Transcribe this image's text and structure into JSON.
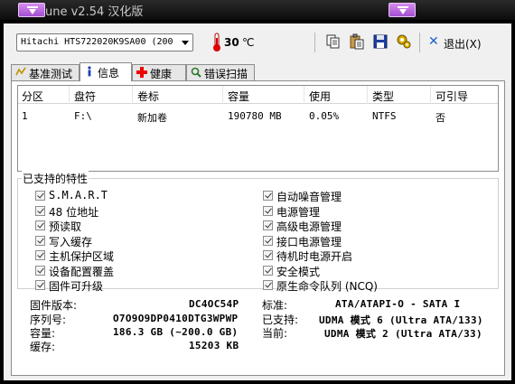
{
  "window": {
    "title": "une v2.54 汉化版",
    "accent_purple": "#b05ad8"
  },
  "toolbar": {
    "drive": "Hitachi HTS722020K9SA00 (200",
    "temperature": "30",
    "temperature_unit": "℃",
    "exit_label": "退出(X)",
    "icons": [
      "copy-icon",
      "paste-icon",
      "save-icon",
      "settings-icon"
    ]
  },
  "tabs": [
    {
      "label": "基准测试",
      "icon": "benchmark-icon"
    },
    {
      "label": "信息",
      "icon": "info-icon",
      "active": true
    },
    {
      "label": "健康",
      "icon": "health-cross-icon"
    },
    {
      "label": "错误扫描",
      "icon": "error-scan-icon"
    }
  ],
  "partitions": {
    "columns": [
      "分区",
      "盘符",
      "卷标",
      "容量",
      "使用",
      "类型",
      "可引导"
    ],
    "rows": [
      [
        "1",
        "F:\\",
        "新加卷",
        "190780 MB",
        "0.05%",
        "NTFS",
        "否"
      ]
    ]
  },
  "features": {
    "label": "已支持的特性",
    "left": [
      "S.M.A.R.T",
      "48 位地址",
      "预读取",
      "写入缓存",
      "主机保护区域",
      "设备配置覆盖",
      "固件可升级"
    ],
    "right": [
      "自动噪音管理",
      "电源管理",
      "高级电源管理",
      "接口电源管理",
      "待机时电源开启",
      "安全模式",
      "原生命令队列 (NCQ)"
    ]
  },
  "info": {
    "firmware_label": "固件版本:",
    "firmware_value": "DC4OC54P",
    "serial_label": "序列号:",
    "serial_value": "O7O9O9DP0410DTG3WPWP",
    "capacity_label": "容量:",
    "capacity_value": "186.3 GB (~200.0 GB)",
    "cache_label": "缓存:",
    "cache_value": "15203 KB",
    "standard_label": "标准:",
    "standard_value": "ATA/ATAPI-O - SATA I",
    "supported_label": "已支持:",
    "supported_value": "UDMA 模式 6 (Ultra ATA/133)",
    "current_label": "当前:",
    "current_value": "UDMA 模式 2 (Ultra ATA/33)"
  }
}
